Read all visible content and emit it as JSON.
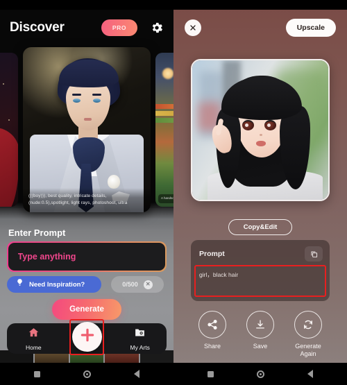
{
  "left": {
    "header": {
      "title": "Discover",
      "pro_label": "PRO",
      "settings_icon": "gear-icon"
    },
    "carousel": {
      "main_card_overlay": "(((boy))), best quality, intricate details, (nude:0.5),spotlight, light rays, photoshoot, ultra",
      "right_card_overlay": "A handso greenst"
    },
    "enter_prompt_label": "Enter Prompt",
    "prompt_input": {
      "value": "",
      "placeholder": "Type anything"
    },
    "inspiration_button": {
      "label": "Need Inspiration?",
      "icon": "lightbulb-icon",
      "color": "#4a6ad4"
    },
    "counter": {
      "text": "0/500",
      "clear_icon": "close-circle-icon"
    },
    "generate_button": {
      "label": "Generate",
      "gradient_from": "#f4497f",
      "gradient_to": "#f79a69"
    },
    "tabbar": {
      "items": [
        {
          "label": "Home",
          "icon": "home-icon"
        },
        {
          "label": "My Arts",
          "icon": "folder-photo-icon"
        }
      ],
      "fab_icon": "plus-icon",
      "highlight_color": "#e81f1f"
    }
  },
  "right": {
    "close_icon": "close-icon",
    "upscale_button": "Upscale",
    "copy_edit_button": "Copy&Edit",
    "prompt_card": {
      "title": "Prompt",
      "copy_icon": "copy-icon",
      "value": "girl，black hair",
      "highlight_color": "#e81f1f"
    },
    "actions": [
      {
        "label": "Share",
        "icon": "share-icon"
      },
      {
        "label": "Save",
        "icon": "download-icon"
      },
      {
        "label": "Generate\nAgain",
        "line1": "Generate",
        "line2": "Again",
        "icon": "refresh-icon"
      }
    ],
    "background_color": "#7d6663"
  },
  "system_nav": {
    "recents_icon": "square-icon",
    "home_icon": "circle-icon",
    "back_icon": "back-chevron-icon"
  }
}
